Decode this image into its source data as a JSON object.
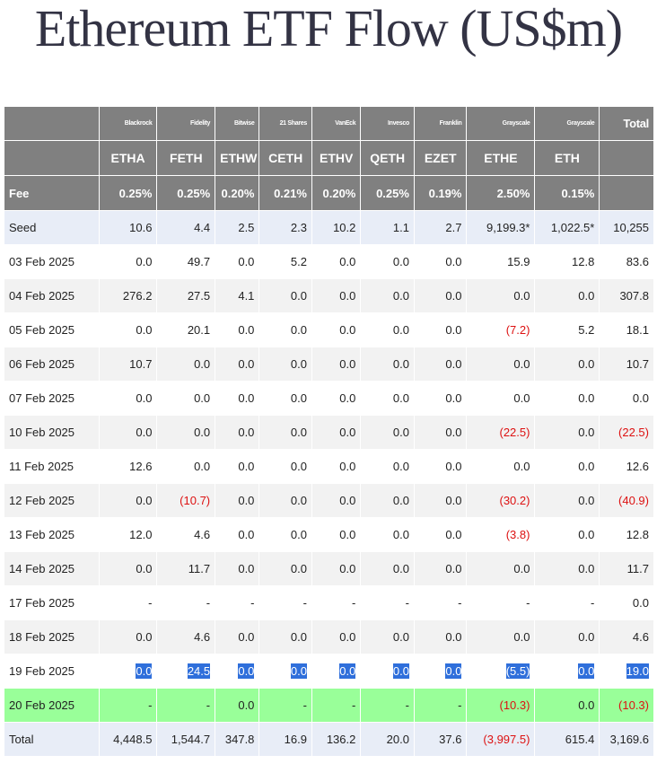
{
  "title": "Ethereum ETF Flow (US$m)",
  "colors": {
    "header_bg": "#808080",
    "negative": "#dd1111",
    "highlight_row": "#99ff99",
    "selection": "#2f6fdb",
    "seed_row": "#e8edf7"
  },
  "header": {
    "issuers": [
      "Blackrock",
      "Fidelity",
      "Bitwise",
      "21 Shares",
      "VanEck",
      "Invesco",
      "Franklin",
      "Grayscale",
      "Grayscale"
    ],
    "total_label": "Total",
    "tickers": [
      "ETHA",
      "FETH",
      "ETHW",
      "CETH",
      "ETHV",
      "QETH",
      "EZET",
      "ETHE",
      "ETH"
    ],
    "fee_label": "Fee",
    "fees": [
      "0.25%",
      "0.25%",
      "0.20%",
      "0.21%",
      "0.20%",
      "0.25%",
      "0.19%",
      "2.50%",
      "0.15%"
    ]
  },
  "rows": [
    {
      "label": "Seed",
      "cells": [
        "10.6",
        "4.4",
        "2.5",
        "2.3",
        "10.2",
        "1.1",
        "2.7",
        "9,199.3*",
        "1,022.5*",
        "10,255"
      ]
    },
    {
      "label": "03 Feb 2025",
      "cells": [
        "0.0",
        "49.7",
        "0.0",
        "5.2",
        "0.0",
        "0.0",
        "0.0",
        "15.9",
        "12.8",
        "83.6"
      ]
    },
    {
      "label": "04 Feb 2025",
      "cells": [
        "276.2",
        "27.5",
        "4.1",
        "0.0",
        "0.0",
        "0.0",
        "0.0",
        "0.0",
        "0.0",
        "307.8"
      ]
    },
    {
      "label": "05 Feb 2025",
      "cells": [
        "0.0",
        "20.1",
        "0.0",
        "0.0",
        "0.0",
        "0.0",
        "0.0",
        "(7.2)",
        "5.2",
        "18.1"
      ]
    },
    {
      "label": "06 Feb 2025",
      "cells": [
        "10.7",
        "0.0",
        "0.0",
        "0.0",
        "0.0",
        "0.0",
        "0.0",
        "0.0",
        "0.0",
        "10.7"
      ]
    },
    {
      "label": "07 Feb 2025",
      "cells": [
        "0.0",
        "0.0",
        "0.0",
        "0.0",
        "0.0",
        "0.0",
        "0.0",
        "0.0",
        "0.0",
        "0.0"
      ]
    },
    {
      "label": "10 Feb 2025",
      "cells": [
        "0.0",
        "0.0",
        "0.0",
        "0.0",
        "0.0",
        "0.0",
        "0.0",
        "(22.5)",
        "0.0",
        "(22.5)"
      ]
    },
    {
      "label": "11 Feb 2025",
      "cells": [
        "12.6",
        "0.0",
        "0.0",
        "0.0",
        "0.0",
        "0.0",
        "0.0",
        "0.0",
        "0.0",
        "12.6"
      ]
    },
    {
      "label": "12 Feb 2025",
      "cells": [
        "0.0",
        "(10.7)",
        "0.0",
        "0.0",
        "0.0",
        "0.0",
        "0.0",
        "(30.2)",
        "0.0",
        "(40.9)"
      ]
    },
    {
      "label": "13 Feb 2025",
      "cells": [
        "12.0",
        "4.6",
        "0.0",
        "0.0",
        "0.0",
        "0.0",
        "0.0",
        "(3.8)",
        "0.0",
        "12.8"
      ]
    },
    {
      "label": "14 Feb 2025",
      "cells": [
        "0.0",
        "11.7",
        "0.0",
        "0.0",
        "0.0",
        "0.0",
        "0.0",
        "0.0",
        "0.0",
        "11.7"
      ]
    },
    {
      "label": "17 Feb 2025",
      "cells": [
        "-",
        "-",
        "-",
        "-",
        "-",
        "-",
        "-",
        "-",
        "-",
        "0.0"
      ]
    },
    {
      "label": "18 Feb 2025",
      "cells": [
        "0.0",
        "4.6",
        "0.0",
        "0.0",
        "0.0",
        "0.0",
        "0.0",
        "0.0",
        "0.0",
        "4.6"
      ]
    },
    {
      "label": "19 Feb 2025",
      "cells": [
        "0.0",
        "24.5",
        "0.0",
        "0.0",
        "0.0",
        "0.0",
        "0.0",
        "(5.5)",
        "0.0",
        "19.0"
      ],
      "selected": true
    },
    {
      "label": "20 Feb 2025",
      "cells": [
        "-",
        "-",
        "0.0",
        "-",
        "-",
        "-",
        "-",
        "(10.3)",
        "0.0",
        "(10.3)"
      ],
      "highlight": true
    },
    {
      "label": "Total",
      "cells": [
        "4,448.5",
        "1,544.7",
        "347.8",
        "16.9",
        "136.2",
        "20.0",
        "37.6",
        "(3,997.5)",
        "615.4",
        "3,169.6"
      ],
      "total": true
    }
  ]
}
